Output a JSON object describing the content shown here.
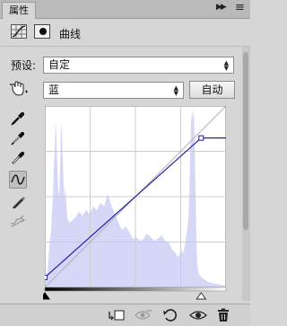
{
  "panel": {
    "tab_label": "属性",
    "adjustment_title": "曲线"
  },
  "preset": {
    "label": "预设:",
    "value": "自定"
  },
  "channel": {
    "value": "蓝",
    "auto_label": "自动"
  },
  "curve": {
    "channel_color": "#1f1fae",
    "histogram_color": "#d6d6f6",
    "input_black": 0,
    "input_white": 220,
    "output_black": 14,
    "output_white": 210
  }
}
